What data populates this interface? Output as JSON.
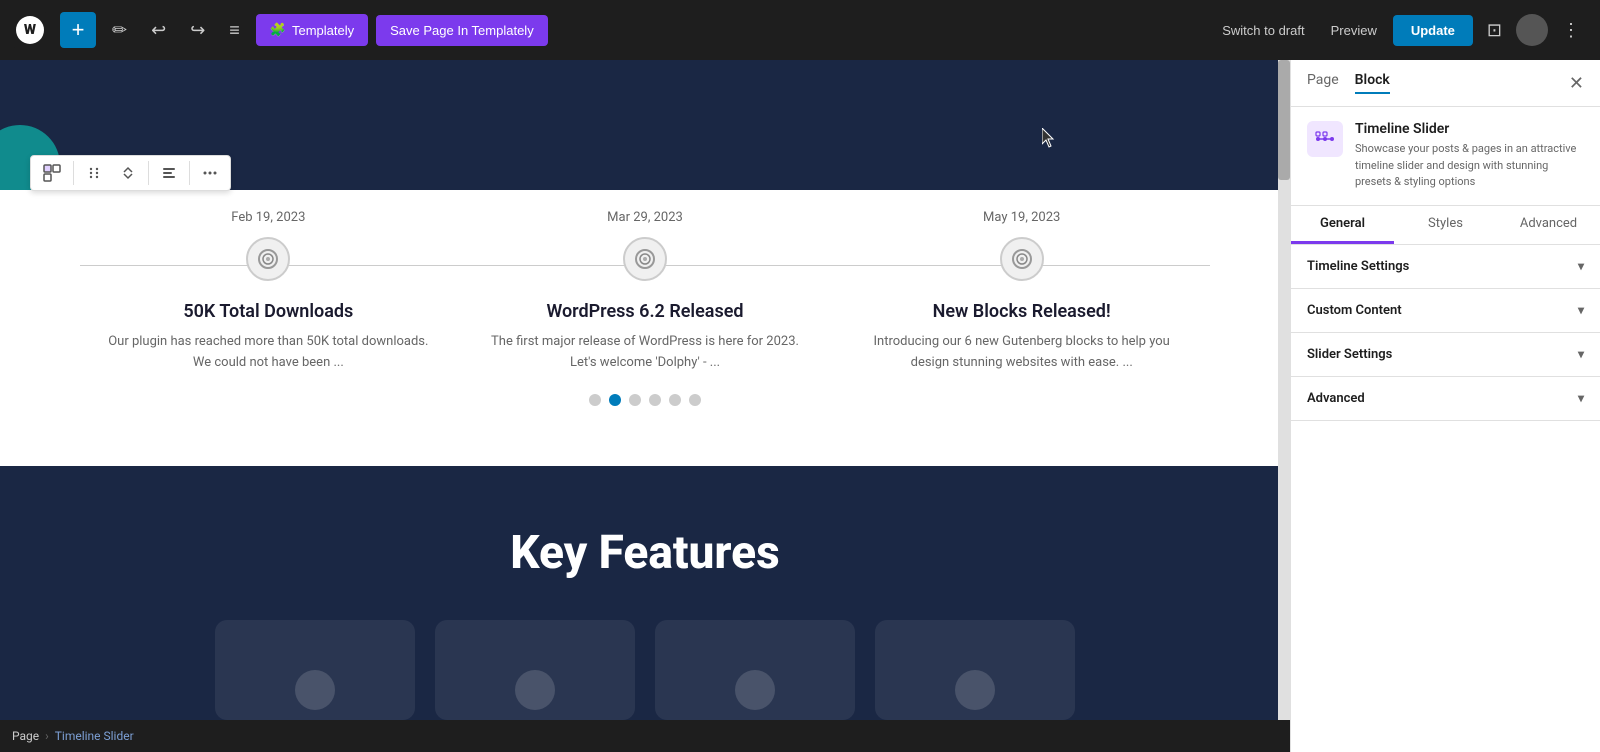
{
  "toolbar": {
    "plus_label": "+",
    "edit_icon": "✏",
    "undo_icon": "↩",
    "redo_icon": "↪",
    "menu_icon": "≡",
    "templately_label": "Templately",
    "save_templately_label": "Save Page In Templately",
    "switch_draft_label": "Switch to draft",
    "preview_label": "Preview",
    "update_label": "Update",
    "settings_icon": "⊡",
    "user_icon": "👤",
    "more_icon": "⋮"
  },
  "block_toolbar": {
    "block_icon": "⊞",
    "drag_icon": "⠿",
    "up_down_icon": "⬍",
    "align_icon": "≡",
    "more_icon": "⋮"
  },
  "timeline": {
    "items": [
      {
        "date": "Feb 19, 2023",
        "title": "50K Total Downloads",
        "description": "Our plugin has reached more than 50K total downloads. We could not have been ..."
      },
      {
        "date": "Mar 29, 2023",
        "title": "WordPress 6.2 Released",
        "description": "The first major release of WordPress is here for 2023. Let's welcome 'Dolphy' - ..."
      },
      {
        "date": "May 19, 2023",
        "title": "New Blocks Released!",
        "description": "Introducing our 6 new Gutenberg blocks to help you design stunning websites with ease. ..."
      }
    ],
    "slider_dots_count": 6,
    "active_dot_index": 1
  },
  "key_features": {
    "title": "Key Features"
  },
  "panel": {
    "tab_page": "Page",
    "tab_block": "Block",
    "close_icon": "✕",
    "block_name": "Timeline Slider",
    "block_description": "Showcase your posts & pages in an attractive timeline slider and design with stunning presets & styling options",
    "sub_tabs": {
      "general": "General",
      "styles": "Styles",
      "advanced": "Advanced"
    },
    "sections": [
      {
        "label": "Timeline Settings"
      },
      {
        "label": "Custom Content"
      },
      {
        "label": "Slider Settings"
      },
      {
        "label": "Advanced"
      }
    ]
  },
  "breadcrumb": {
    "page": "Page",
    "separator": "›",
    "current": "Timeline Slider"
  }
}
